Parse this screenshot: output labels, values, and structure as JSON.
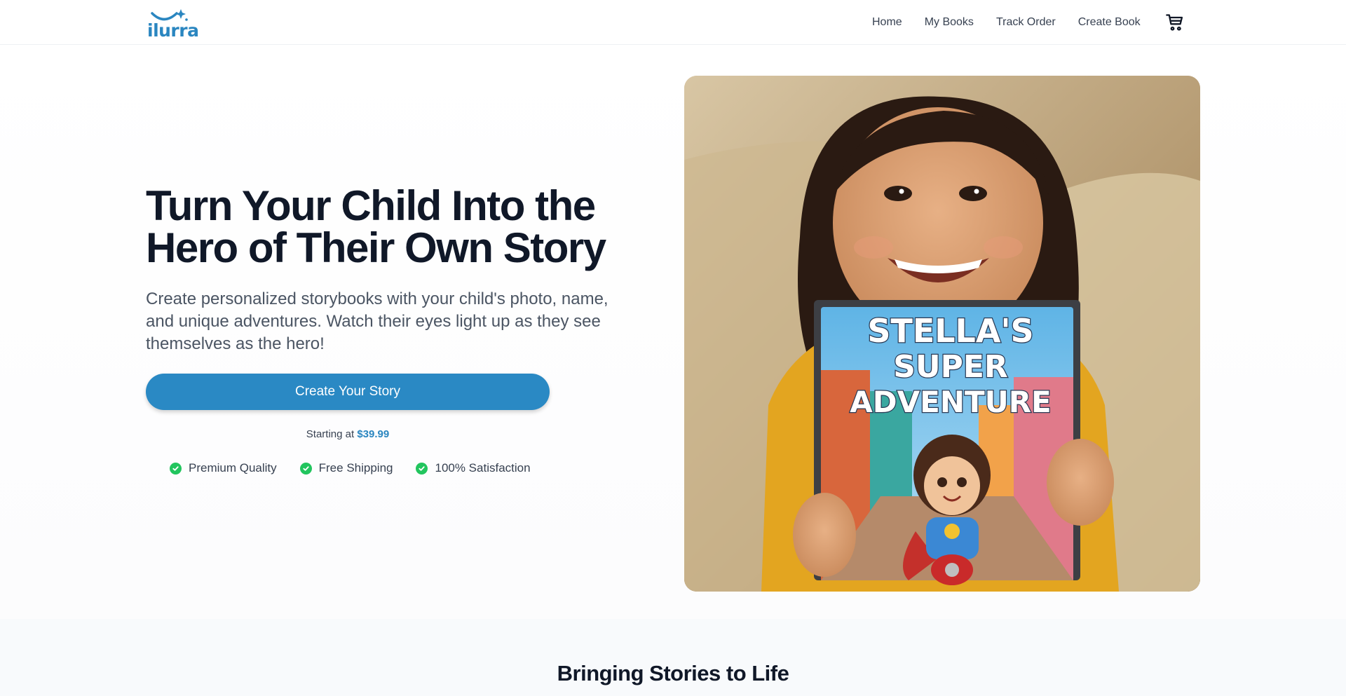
{
  "brand": {
    "logo_text": "ilurra",
    "accent_color": "#2a86c0"
  },
  "nav": {
    "items": [
      "Home",
      "My Books",
      "Track Order",
      "Create Book"
    ],
    "cart_icon": "cart-icon"
  },
  "hero": {
    "headline": "Turn Your Child Into the Hero of Their Own Story",
    "subtext": "Create personalized storybooks with your child's photo, name, and unique adventures. Watch their eyes light up as they see themselves as the hero!",
    "cta_label": "Create Your Story",
    "price_prefix": "Starting at ",
    "price": "$39.99",
    "features": [
      "Premium Quality",
      "Free Shipping",
      "100% Satisfaction"
    ],
    "feature_icon": "check-circle-icon",
    "book_title_lines": [
      "STELLA'S",
      "SUPER",
      "ADVENTURE"
    ]
  },
  "section2": {
    "title": "Bringing Stories to Life"
  }
}
